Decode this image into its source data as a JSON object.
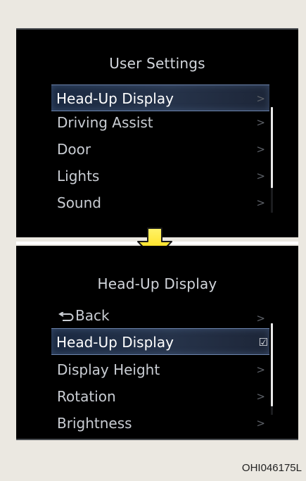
{
  "top_screen": {
    "title": "User Settings",
    "items": [
      {
        "label": "Head-Up Display",
        "selected": true,
        "indicator": ">"
      },
      {
        "label": "Driving Assist",
        "selected": false,
        "indicator": ">"
      },
      {
        "label": "Door",
        "selected": false,
        "indicator": ">"
      },
      {
        "label": "Lights",
        "selected": false,
        "indicator": ">"
      },
      {
        "label": "Sound",
        "selected": false,
        "indicator": ">"
      }
    ]
  },
  "bottom_screen": {
    "title": "Head-Up Display",
    "back_label": "Back",
    "items": [
      {
        "label": "Head-Up Display",
        "selected": true,
        "indicator": "☑"
      },
      {
        "label": "Display Height",
        "selected": false,
        "indicator": ">"
      },
      {
        "label": "Rotation",
        "selected": false,
        "indicator": ">"
      },
      {
        "label": "Brightness",
        "selected": false,
        "indicator": ">"
      }
    ],
    "back_indicator": ">"
  },
  "transition_icon": "down-arrow-icon",
  "image_code": "OHI046175L",
  "colors": {
    "screen_bg": "#000000",
    "page_bg": "#ebe8e1",
    "selection_border": "#6c84ad",
    "arrow_fill": "#ffe600"
  }
}
